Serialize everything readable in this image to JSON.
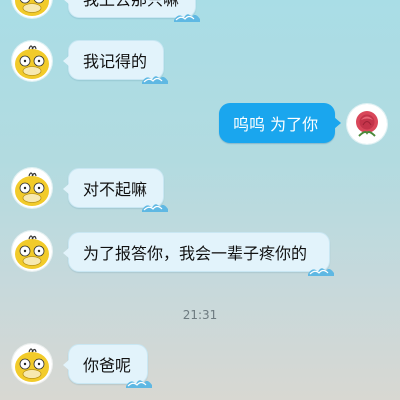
{
  "messages": [
    {
      "text": "我上去那只嘛",
      "side": "in"
    },
    {
      "text": "我记得的",
      "side": "in"
    },
    {
      "text": "呜呜 为了你",
      "side": "out"
    },
    {
      "text": "对不起嘛",
      "side": "in"
    },
    {
      "text": "为了报答你，我会一辈子疼你的",
      "side": "in"
    },
    {
      "text": "你爸呢",
      "side": "in"
    }
  ],
  "timestamp": "21:31",
  "avatars": {
    "incoming_icon": "psyduck-avatar-icon",
    "outgoing_icon": "rose-avatar-icon"
  },
  "colors": {
    "incoming_bubble": "#e2f3fb",
    "outgoing_bubble": "#1aa6ee",
    "background_top": "#a9dde6",
    "background_bottom": "#d8d8d2"
  }
}
